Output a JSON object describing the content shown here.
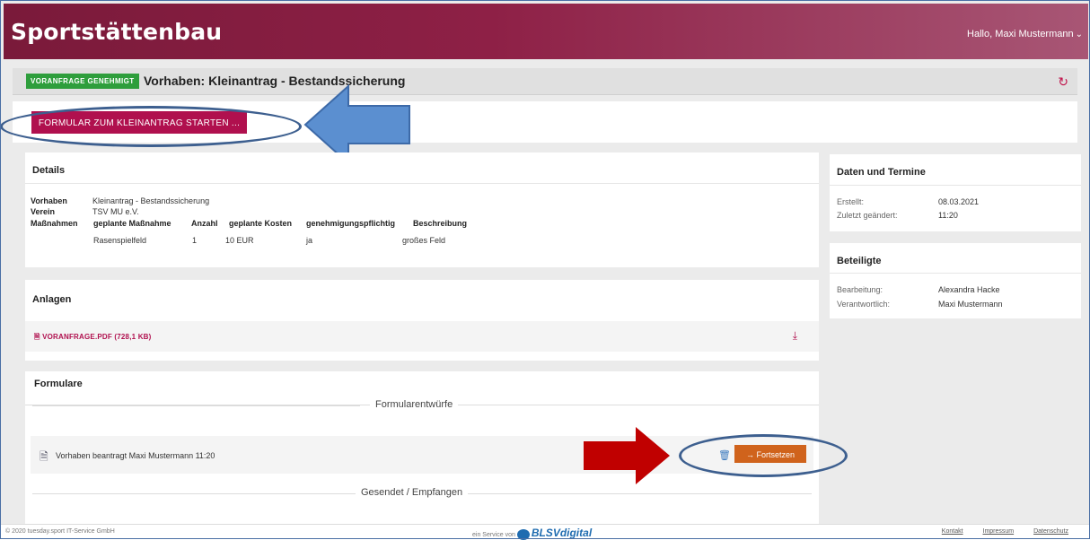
{
  "header": {
    "brand": "Sportstättenbau",
    "user_greeting": "Hallo, Maxi Mustermann"
  },
  "project": {
    "badge": "VORANFRAGE GENEHMIGT",
    "title": "Vorhaben: Kleinantrag - Bestandssicherung"
  },
  "actions": {
    "start_form_label": "FORMULAR ZUM KLEINANTRAG STARTEN ..."
  },
  "details": {
    "heading": "Details",
    "vorhaben_label": "Vorhaben",
    "vorhaben_value": "Kleinantrag - Bestandssicherung",
    "verein_label": "Verein",
    "verein_value": "TSV MU e.V.",
    "massnahmen_label": "Maßnahmen",
    "columns": [
      "geplante Maßnahme",
      "Anzahl",
      "geplante Kosten",
      "genehmigungspflichtig",
      "Beschreibung"
    ],
    "row": [
      "Rasenspielfeld",
      "1",
      "10 EUR",
      "ja",
      "großes Feld"
    ]
  },
  "anlagen": {
    "heading": "Anlagen",
    "file": "VORANFRAGE.PDF (728,1 KB)"
  },
  "formulare": {
    "heading": "Formulare",
    "drafts_label": "Formularentwürfe",
    "draft_text": "Vorhaben beantragt  Maxi Mustermann  11:20",
    "continue_label": "Fortsetzen",
    "sent_label": "Gesendet / Empfangen"
  },
  "termine": {
    "heading": "Daten und Termine",
    "created_label": "Erstellt:",
    "created_value": "08.03.2021",
    "changed_label": "Zuletzt geändert:",
    "changed_value": "11:20"
  },
  "beteiligte": {
    "heading": "Beteiligte",
    "processing_label": "Bearbeitung:",
    "processing_value": "Alexandra Hacke",
    "responsible_label": "Verantwortlich:",
    "responsible_value": "Maxi Mustermann"
  },
  "footer": {
    "copyright": "© 2020 tuesday.sport IT-Service GmbH",
    "service_prefix": "ein Service von",
    "service_brand": "BLSVdigital",
    "links": [
      "Kontakt",
      "Impressum",
      "Datenschutz"
    ]
  },
  "colors": {
    "brand": "#8e2046",
    "accent": "#b0104e",
    "success": "#2e9e3c",
    "continue": "#d0631c",
    "annotation_blue": "#3d5f8f",
    "annotation_red": "#c00000"
  }
}
